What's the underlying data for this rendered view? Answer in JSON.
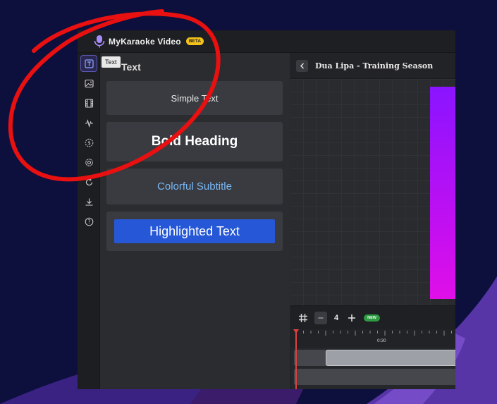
{
  "app": {
    "title": "MyKaraoke Video",
    "badge": "BETA"
  },
  "sidebar": {
    "tooltip": "Text",
    "items": [
      {
        "icon": "text-icon",
        "active": true
      },
      {
        "icon": "image-icon"
      },
      {
        "icon": "film-icon"
      },
      {
        "icon": "waveform-icon"
      },
      {
        "icon": "dollar-circle-icon"
      },
      {
        "icon": "gear-icon"
      },
      {
        "icon": "refresh-icon"
      },
      {
        "icon": "download-icon"
      },
      {
        "icon": "help-icon"
      }
    ]
  },
  "panel": {
    "heading": "Text",
    "presets": {
      "simple": "Simple Text",
      "bold": "Bold Heading",
      "colorful": "Colorful Subtitle",
      "highlighted": "Highlighted Text"
    }
  },
  "editor": {
    "song_title": "Dua Lipa - Training Season"
  },
  "timeline": {
    "zoom_level": "4",
    "new_badge": "NEW",
    "ruler_label": "0:30"
  },
  "colors": {
    "background": "#0d0f3d",
    "accent": "#2557d6",
    "beta": "#f4c21b",
    "new": "#2e9b42",
    "annotation": "#e81010",
    "preview_start": "#8a14ff",
    "preview_end": "#e00fe8"
  }
}
